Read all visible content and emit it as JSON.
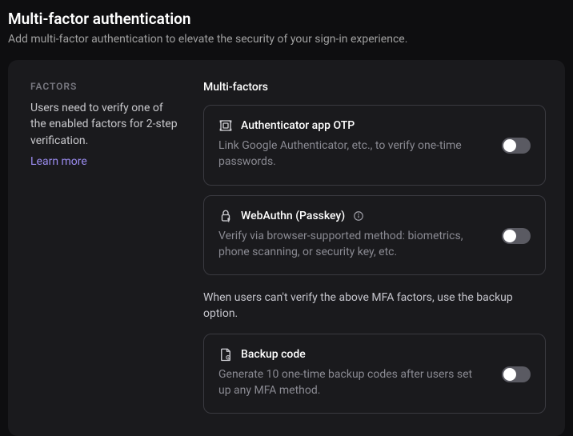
{
  "header": {
    "title": "Multi-factor authentication",
    "subtitle": "Add multi-factor authentication to elevate the security of your sign-in experience."
  },
  "sidebar": {
    "label": "FACTORS",
    "description": "Users need to verify one of the enabled factors for 2-step verification.",
    "learn_more": "Learn more"
  },
  "main": {
    "group_title": "Multi-factors",
    "backup_note": "When users can't verify the above MFA factors, use the backup option.",
    "factors": [
      {
        "icon": "authenticator-otp-icon",
        "title": "Authenticator app OTP",
        "description": "Link Google Authenticator, etc., to verify one-time passwords.",
        "enabled": false,
        "info": false
      },
      {
        "icon": "passkey-icon",
        "title": "WebAuthn (Passkey)",
        "description": "Verify via browser-supported method: biometrics, phone scanning, or security key, etc.",
        "enabled": false,
        "info": true
      },
      {
        "icon": "backup-code-icon",
        "title": "Backup code",
        "description": "Generate 10 one-time backup codes after users set up any MFA method.",
        "enabled": false,
        "info": false
      }
    ]
  }
}
